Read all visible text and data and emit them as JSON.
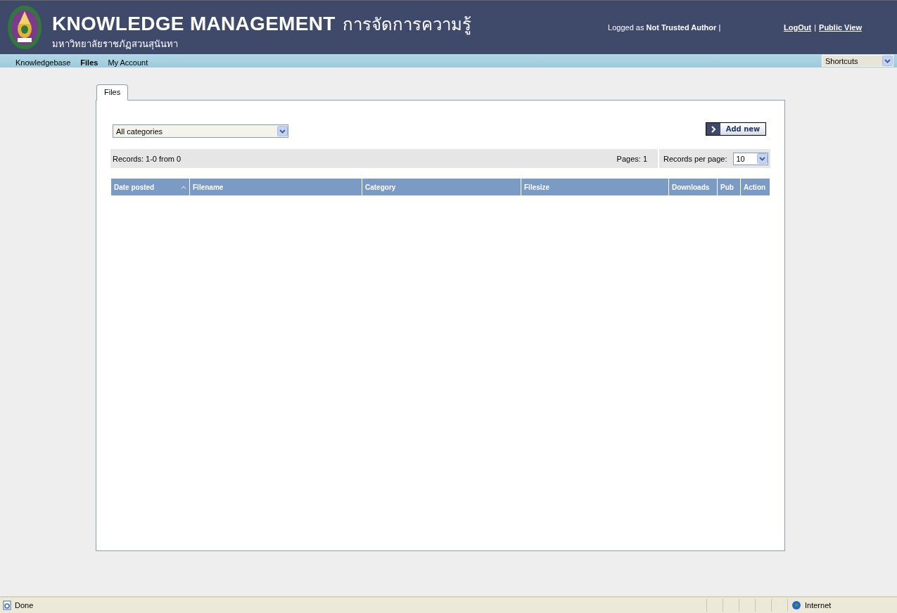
{
  "header": {
    "title": "KNOWLEDGE MANAGEMENT",
    "title_thai": "การจัดการความรู้",
    "subtitle": "มหาวิทยาลัยราชภัฏสวนสุนันทา",
    "login_text": "Logged as **Not Trusted Author** |",
    "links": [
      {
        "label": "LogOut"
      },
      {
        "label": "Public View"
      }
    ],
    "link_separator": "|"
  },
  "nav": {
    "items": [
      {
        "label": "Knowledgebase",
        "selected": false
      },
      {
        "label": "Files",
        "selected": true
      },
      {
        "label": "My Account",
        "selected": false
      }
    ],
    "shortcuts": {
      "value": "Shortcuts"
    }
  },
  "tabs": [
    {
      "label": "Files",
      "selected": true
    }
  ],
  "files": {
    "category_select": {
      "value": "All categories"
    },
    "add_button": "Add new",
    "records": "Records: 1-0 from 0",
    "pages": "Pages: 1",
    "per_page_label": "Records per page:",
    "per_page": {
      "value": "10"
    },
    "table": {
      "columns": [
        {
          "label": "Date posted",
          "sorted": true
        },
        {
          "label": "Filename",
          "sorted": false
        },
        {
          "label": "Category",
          "sorted": false
        },
        {
          "label": "Filesize",
          "sorted": false
        },
        {
          "label": "Downloads",
          "sorted": false
        },
        {
          "label": "Pub",
          "sorted": false
        },
        {
          "label": "Action",
          "sorted": false
        }
      ]
    }
  },
  "status_bar": {
    "text": "Done",
    "zone": "Internet"
  }
}
